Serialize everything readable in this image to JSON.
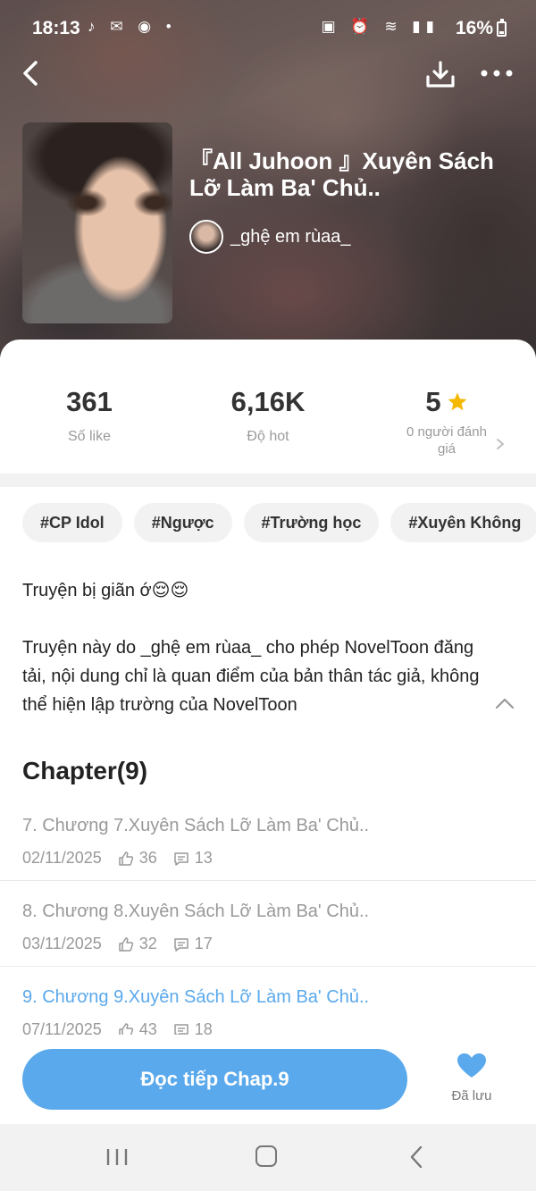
{
  "status_bar": {
    "time": "18:13",
    "left_icons": "♪ ✉ ◉ •",
    "right_icons": "▣ ⏰ ≋ ▮▮",
    "battery": "16%"
  },
  "header": {
    "title": "『All Juhoon 』Xuyên Sách Lỡ Làm Ba' Chủ..",
    "author": "_ghệ em rùaa_",
    "icons": [
      "back-arrow-icon",
      "download-icon",
      "more-icon"
    ]
  },
  "stats": {
    "likes_value": "361",
    "likes_label": "Số like",
    "hot_value": "6,16K",
    "hot_label": "Độ hot",
    "rating_value": "5",
    "rating_label": "0 người đánh giá"
  },
  "tags": [
    "#CP Idol",
    "#Ngược",
    "#Trường học",
    "#Xuyên Không"
  ],
  "description": {
    "line1": "Truyện bị giãn ớ😌😌",
    "line2": "Truyện này do _ghệ em rùaa_ cho phép NovelToon đăng tải, nội dung chỉ là quan điểm của bản thân tác giả, không thể hiện lập trường của NovelToon"
  },
  "chapters": {
    "heading": "Chapter(9)",
    "items": [
      {
        "title": "7. Chương 7.Xuyên Sách Lỡ Làm Ba' Chủ..",
        "date": "02/11/2025",
        "likes": "36",
        "comments": "13"
      },
      {
        "title": "8. Chương 8.Xuyên Sách Lỡ Làm Ba' Chủ..",
        "date": "03/11/2025",
        "likes": "32",
        "comments": "17"
      },
      {
        "title": "9. Chương 9.Xuyên Sách Lỡ Làm Ba' Chủ..",
        "date": "07/11/2025",
        "likes": "43",
        "comments": "18"
      }
    ]
  },
  "bottom": {
    "read_label": "Đọc tiếp Chap.9",
    "save_label": "Đã lưu"
  },
  "colors": {
    "accent": "#5aa9ec",
    "star": "#f5b800"
  }
}
